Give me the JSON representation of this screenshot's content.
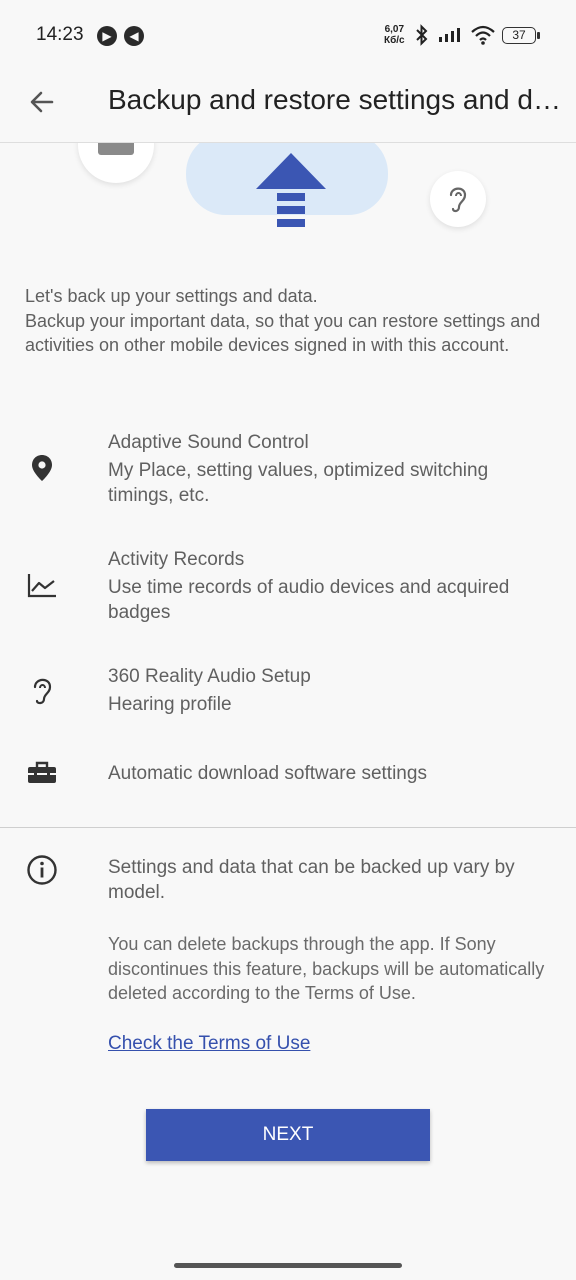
{
  "status_bar": {
    "time": "14:23",
    "speed_value": "6,07",
    "speed_unit": "Кб/с",
    "battery": "37"
  },
  "header": {
    "title": "Backup and restore settings and data"
  },
  "intro": {
    "line1": "Let's back up your settings and data.",
    "line2": "Backup your important data, so that you can restore settings and activities on other mobile devices signed in with this account."
  },
  "items": [
    {
      "icon": "location-pin-icon",
      "title": "Adaptive Sound Control",
      "description": "My Place, setting values, optimized switching timings, etc."
    },
    {
      "icon": "chart-line-icon",
      "title": "Activity Records",
      "description": "Use time records of audio devices and acquired badges"
    },
    {
      "icon": "ear-icon",
      "title": "360 Reality Audio Setup",
      "description": "Hearing profile"
    },
    {
      "icon": "toolbox-icon",
      "title": "Automatic download software settings"
    }
  ],
  "note": {
    "icon": "info-icon",
    "main": "Settings and data that can be backed up vary by model.",
    "sub": "You can delete backups through the app. If Sony discontinues this feature, backups will be automatically deleted according to the Terms of Use.",
    "link": "Check the Terms of Use"
  },
  "actions": {
    "next_label": "NEXT"
  },
  "colors": {
    "accent": "#3b56b3",
    "link": "#3550ad",
    "cloud": "#dbe9f8"
  }
}
